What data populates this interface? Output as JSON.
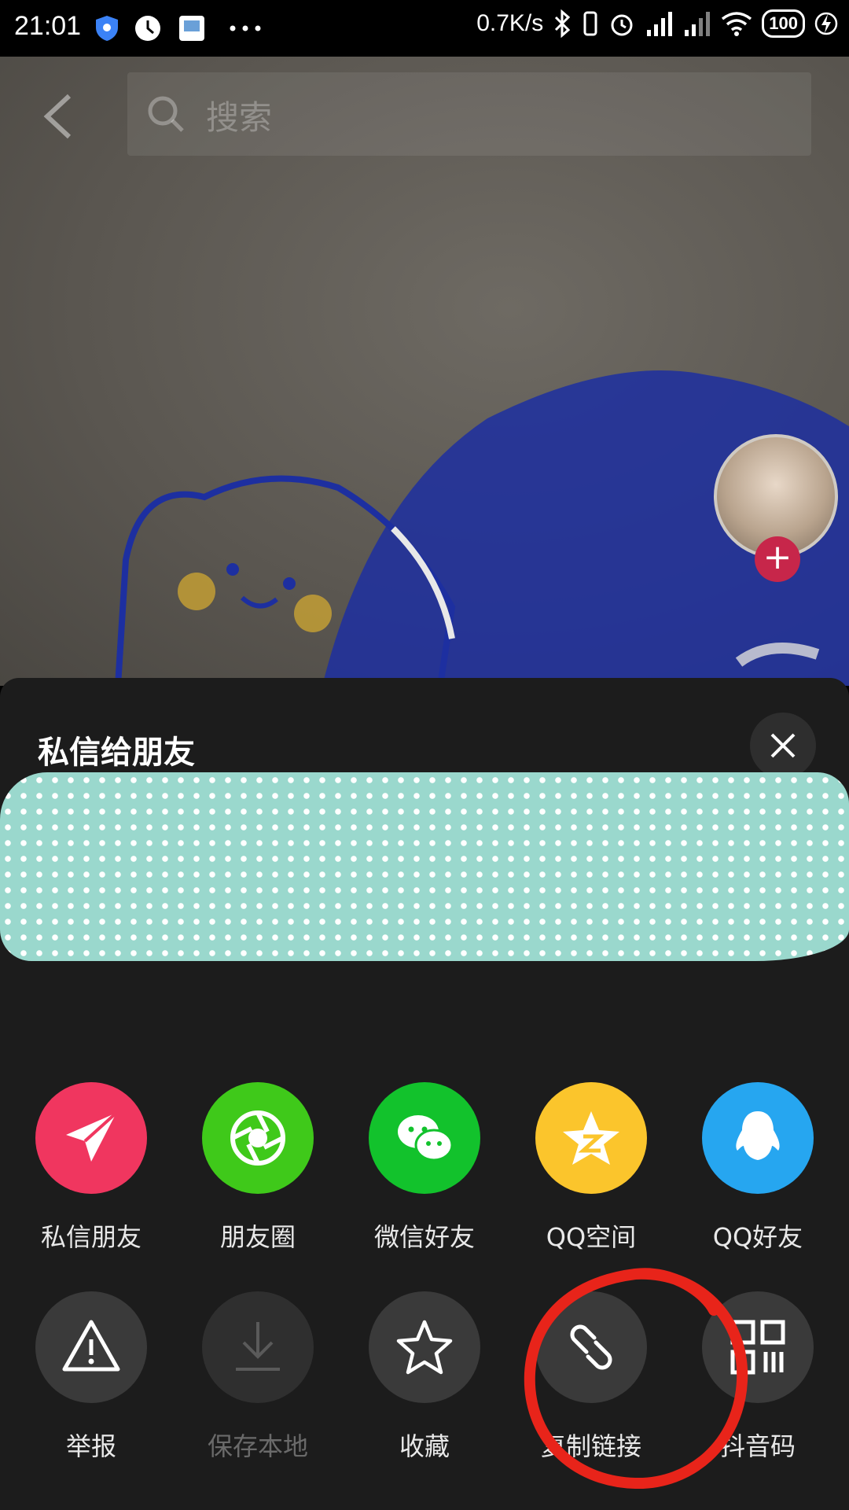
{
  "status_bar": {
    "time": "21:01",
    "net_speed": "0.7K/s",
    "battery": "100",
    "icons": [
      "shield-icon",
      "clock-app-icon",
      "app-icon",
      "more-dots-icon",
      "bluetooth-icon",
      "vibrate-icon",
      "alarm-icon",
      "signal-icon",
      "hd-signal-icon",
      "wifi-icon",
      "battery-icon",
      "charging-icon"
    ]
  },
  "top": {
    "search_placeholder": "搜索"
  },
  "sheet": {
    "title": "私信给朋友",
    "share_row": [
      {
        "label": "私信朋友",
        "icon": "send-icon",
        "color": "#f0365f"
      },
      {
        "label": "朋友圈",
        "icon": "moments-icon",
        "color": "#3fc91a"
      },
      {
        "label": "微信好友",
        "icon": "wechat-icon",
        "color": "#12c22c"
      },
      {
        "label": "QQ空间",
        "icon": "qzone-icon",
        "color": "#fbc52c"
      },
      {
        "label": "QQ好友",
        "icon": "qq-icon",
        "color": "#26a6f0"
      }
    ],
    "action_row": [
      {
        "label": "举报",
        "icon": "report-icon"
      },
      {
        "label": "保存本地",
        "icon": "download-icon",
        "disabled": true
      },
      {
        "label": "收藏",
        "icon": "star-icon"
      },
      {
        "label": "复制链接",
        "icon": "link-icon"
      },
      {
        "label": "抖音码",
        "icon": "qrcode-icon"
      }
    ]
  }
}
